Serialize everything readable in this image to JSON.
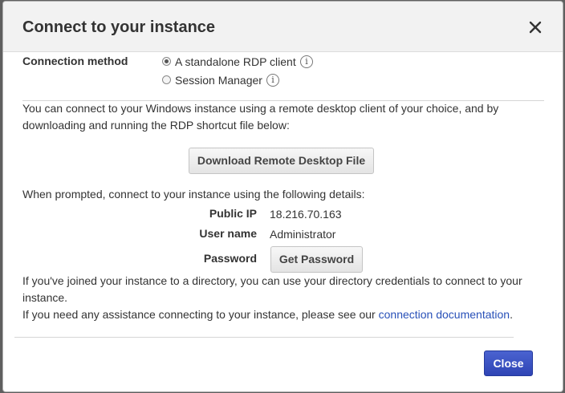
{
  "dialog": {
    "title": "Connect to your instance",
    "close_icon": "close-icon"
  },
  "connection": {
    "label": "Connection method",
    "options": [
      {
        "label": "A standalone RDP client",
        "selected": true
      },
      {
        "label": "Session Manager",
        "selected": false
      }
    ]
  },
  "body": {
    "intro": "You can connect to your Windows instance using a remote desktop client of your choice, and by downloading and running the RDP shortcut file below:",
    "download_button": "Download Remote Desktop File",
    "prompt": "When prompted, connect to your instance using the following details:",
    "details": {
      "public_ip_label": "Public IP",
      "public_ip_value": "18.216.70.163",
      "user_name_label": "User name",
      "user_name_value": "Administrator",
      "password_label": "Password",
      "password_button": "Get Password"
    },
    "directory_note": "If you've joined your instance to a directory, you can use your directory credentials to connect to your instance.",
    "assist_prefix": "If you need any assistance connecting to your instance, please see our",
    "assist_link": "connection documentation",
    "assist_suffix": "."
  },
  "footer": {
    "close_button": "Close"
  },
  "colors": {
    "primary": "#2f45b5",
    "link": "#2850b8"
  }
}
